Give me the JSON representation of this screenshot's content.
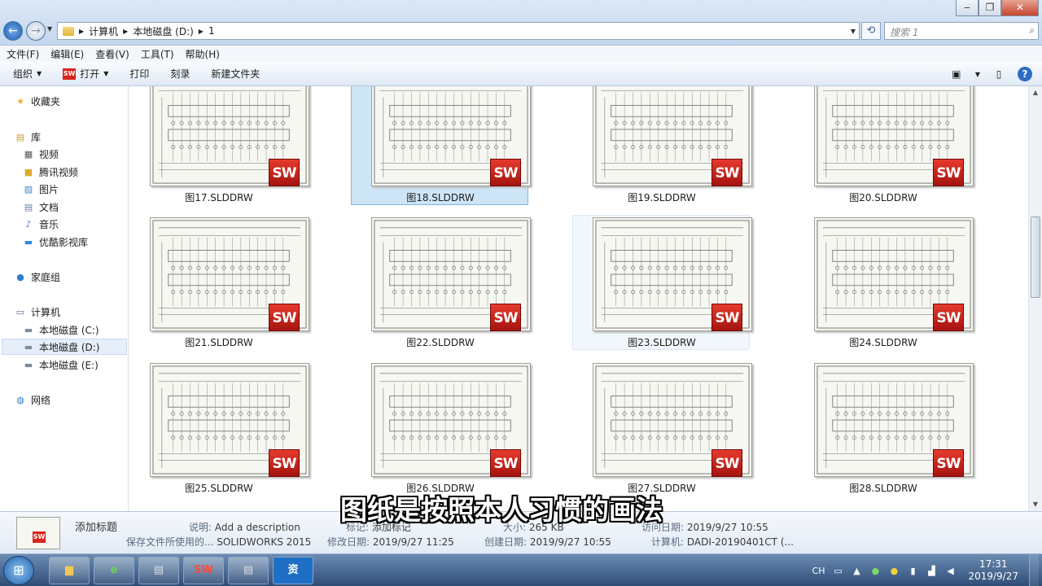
{
  "window": {
    "breadcrumb": [
      "计算机",
      "本地磁盘 (D:)",
      "1"
    ],
    "search_placeholder": "搜索 1",
    "controls": [
      "‒",
      "❐",
      "✕"
    ]
  },
  "menubar": [
    "文件(F)",
    "编辑(E)",
    "查看(V)",
    "工具(T)",
    "帮助(H)"
  ],
  "toolbar": {
    "organize": "组织",
    "open": "打开",
    "print": "打印",
    "burn": "刻录",
    "new_folder": "新建文件夹"
  },
  "nav": {
    "favorites": "收藏夹",
    "library": "库",
    "library_items": [
      "视频",
      "腾讯视频",
      "图片",
      "文档",
      "音乐",
      "优酷影视库"
    ],
    "homegroup": "家庭组",
    "computer": "计算机",
    "drives": [
      "本地磁盘 (C:)",
      "本地磁盘 (D:)",
      "本地磁盘 (E:)"
    ],
    "network": "网络"
  },
  "files": [
    {
      "name": "图17.SLDDRW",
      "state": "normal"
    },
    {
      "name": "图18.SLDDRW",
      "state": "selected"
    },
    {
      "name": "图19.SLDDRW",
      "state": "normal"
    },
    {
      "name": "图20.SLDDRW",
      "state": "normal"
    },
    {
      "name": "图21.SLDDRW",
      "state": "normal"
    },
    {
      "name": "图22.SLDDRW",
      "state": "normal"
    },
    {
      "name": "图23.SLDDRW",
      "state": "hover"
    },
    {
      "name": "图24.SLDDRW",
      "state": "normal"
    },
    {
      "name": "图25.SLDDRW",
      "state": "normal"
    },
    {
      "name": "图26.SLDDRW",
      "state": "normal"
    },
    {
      "name": "图27.SLDDRW",
      "state": "normal"
    },
    {
      "name": "图28.SLDDRW",
      "state": "normal"
    }
  ],
  "badge_text": "SW",
  "details": {
    "title": "添加标题",
    "desc_key": "说明:",
    "desc_val": "Add a description",
    "tag_key": "标记:",
    "tag_val": "添加标记",
    "size_key": "大小:",
    "size_val": "265 KB",
    "saved_by_key": "保存文件所使用的...",
    "saved_by_val": "SOLIDWORKS 2015",
    "modified_key": "修改日期:",
    "modified_val": "2019/9/27 11:25",
    "created_key": "创建日期:",
    "created_val": "2019/9/27 10:55",
    "accessed_key": "访问日期:",
    "accessed_val": "2019/9/27 10:55",
    "computer_key": "计算机:",
    "computer_val": "DADI-20190401CT (..."
  },
  "subtitle": "图纸是按照本人习惯的画法",
  "taskbar": {
    "items": [
      "explorer",
      "ie",
      "sw-file",
      "solidworks-2015",
      "sw-file-2",
      "tencent"
    ],
    "tray_lang": "CH",
    "time": "17:31",
    "date": "2019/9/27"
  },
  "colors": {
    "accent": "#2d6dc4",
    "selection": "#cde5f7",
    "sw_red": "#d9261c"
  }
}
